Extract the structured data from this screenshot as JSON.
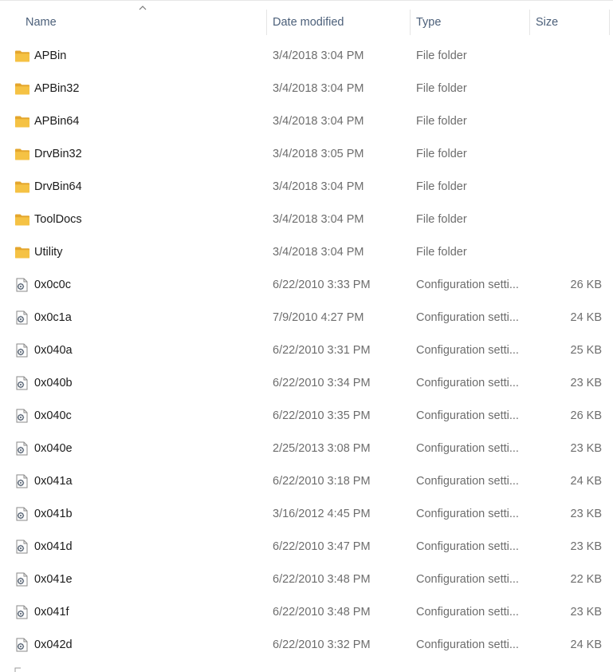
{
  "columns": {
    "name": "Name",
    "date": "Date modified",
    "type": "Type",
    "size": "Size"
  },
  "sort": {
    "column": "name",
    "direction": "ascending",
    "icon": "chevron-up-icon"
  },
  "colors": {
    "folder": "#f5c244",
    "folder_dark": "#e4a62d",
    "header_text": "#4c607a",
    "detail_text": "#6d6d6d"
  },
  "files": [
    {
      "name": "APBin",
      "date": "3/4/2018 3:04 PM",
      "type": "File folder",
      "size": "",
      "icon": "folder-icon"
    },
    {
      "name": "APBin32",
      "date": "3/4/2018 3:04 PM",
      "type": "File folder",
      "size": "",
      "icon": "folder-icon"
    },
    {
      "name": "APBin64",
      "date": "3/4/2018 3:04 PM",
      "type": "File folder",
      "size": "",
      "icon": "folder-icon"
    },
    {
      "name": "DrvBin32",
      "date": "3/4/2018 3:05 PM",
      "type": "File folder",
      "size": "",
      "icon": "folder-icon"
    },
    {
      "name": "DrvBin64",
      "date": "3/4/2018 3:04 PM",
      "type": "File folder",
      "size": "",
      "icon": "folder-icon"
    },
    {
      "name": "ToolDocs",
      "date": "3/4/2018 3:04 PM",
      "type": "File folder",
      "size": "",
      "icon": "folder-icon"
    },
    {
      "name": "Utility",
      "date": "3/4/2018 3:04 PM",
      "type": "File folder",
      "size": "",
      "icon": "folder-icon"
    },
    {
      "name": "0x0c0c",
      "date": "6/22/2010 3:33 PM",
      "type": "Configuration setti...",
      "size": "26 KB",
      "icon": "config-file-icon"
    },
    {
      "name": "0x0c1a",
      "date": "7/9/2010 4:27 PM",
      "type": "Configuration setti...",
      "size": "24 KB",
      "icon": "config-file-icon"
    },
    {
      "name": "0x040a",
      "date": "6/22/2010 3:31 PM",
      "type": "Configuration setti...",
      "size": "25 KB",
      "icon": "config-file-icon"
    },
    {
      "name": "0x040b",
      "date": "6/22/2010 3:34 PM",
      "type": "Configuration setti...",
      "size": "23 KB",
      "icon": "config-file-icon"
    },
    {
      "name": "0x040c",
      "date": "6/22/2010 3:35 PM",
      "type": "Configuration setti...",
      "size": "26 KB",
      "icon": "config-file-icon"
    },
    {
      "name": "0x040e",
      "date": "2/25/2013 3:08 PM",
      "type": "Configuration setti...",
      "size": "23 KB",
      "icon": "config-file-icon"
    },
    {
      "name": "0x041a",
      "date": "6/22/2010 3:18 PM",
      "type": "Configuration setti...",
      "size": "24 KB",
      "icon": "config-file-icon"
    },
    {
      "name": "0x041b",
      "date": "3/16/2012 4:45 PM",
      "type": "Configuration setti...",
      "size": "23 KB",
      "icon": "config-file-icon"
    },
    {
      "name": "0x041d",
      "date": "6/22/2010 3:47 PM",
      "type": "Configuration setti...",
      "size": "23 KB",
      "icon": "config-file-icon"
    },
    {
      "name": "0x041e",
      "date": "6/22/2010 3:48 PM",
      "type": "Configuration setti...",
      "size": "22 KB",
      "icon": "config-file-icon"
    },
    {
      "name": "0x041f",
      "date": "6/22/2010 3:48 PM",
      "type": "Configuration setti...",
      "size": "23 KB",
      "icon": "config-file-icon"
    },
    {
      "name": "0x042d",
      "date": "6/22/2010 3:32 PM",
      "type": "Configuration setti...",
      "size": "24 KB",
      "icon": "config-file-icon"
    }
  ]
}
